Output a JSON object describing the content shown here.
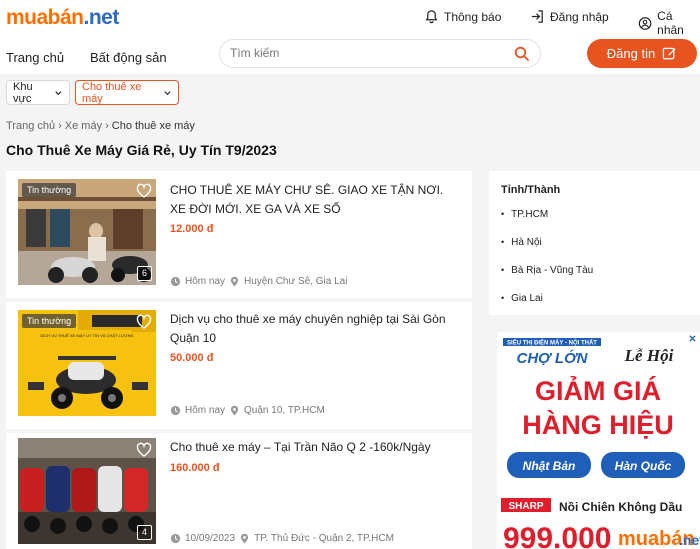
{
  "header": {
    "logo_part1": "muabán",
    "logo_part2": ".net",
    "notifications": "Thông báo",
    "login": "Đăng nhập",
    "account": "Cá nhân",
    "menu_home": "Trang chủ",
    "menu_realestate": "Bất động sản",
    "search_placeholder": "Tìm kiếm",
    "post_button": "Đăng tin"
  },
  "filters": {
    "region": "Khu vực",
    "category": "Cho thuê xe máy"
  },
  "breadcrumb": [
    "Trang chủ",
    "Xe máy",
    "Cho thuê xe máy"
  ],
  "page_title": "Cho Thuê Xe Máy Giá Rẻ, Uy Tín T9/2023",
  "listings": [
    {
      "tag": "Tin thường",
      "title": "CHO THUÊ XE MÁY CHƯ SÊ. GIAO XE TẬN NƠI. XE ĐỜI MỚI. XE GA VÀ XE SỐ",
      "price": "12.000 đ",
      "time": "Hôm nay",
      "location": "Huyện Chư Sê, Gia Lai",
      "photo_count": "6"
    },
    {
      "tag": "Tin thường",
      "title": "Dịch vụ cho thuê xe máy chuyên nghiệp tại Sài Gòn Quận 10",
      "price": "50.000 đ",
      "time": "Hôm nay",
      "location": "Quận 10, TP.HCM",
      "banner_text": "DỊCH VỤ THUÊ XE MÁY UY TÍN VÀ CHẤT LƯỢNG"
    },
    {
      "title": "Cho thuê xe máy – Tại Trần Não Q 2 -160k/Ngày",
      "price": "160.000 đ",
      "time": "10/09/2023",
      "location": "TP. Thủ Đức - Quận 2, TP.HCM",
      "photo_count": "4"
    }
  ],
  "sidebar": {
    "heading": "Tỉnh/Thành",
    "items": [
      "TP.HCM",
      "Hà Nội",
      "Bà Rịa - Vũng Tàu",
      "Gia Lai"
    ]
  },
  "ad": {
    "top_line": "SIÊU THỊ ĐIỆN MÁY - NỘI THẤT",
    "store": "CHỢ LỚN",
    "festival": "Lễ Hội",
    "headline1": "GIẢM GIÁ",
    "headline2": "HÀNG HIỆU",
    "tag1": "Nhật Bản",
    "tag2": "Hàn Quốc",
    "brand": "SHARP",
    "product": "Nồi Chiên Không Dầu",
    "price_partial": "999.000",
    "watermark1": "muabán",
    "watermark2": ".net"
  },
  "colors": {
    "accent": "#e8541f",
    "logo_orange": "#ff6f00",
    "logo_blue": "#2c6bbf",
    "ad_red": "#e01e2b",
    "ad_blue": "#1f5fb8"
  }
}
